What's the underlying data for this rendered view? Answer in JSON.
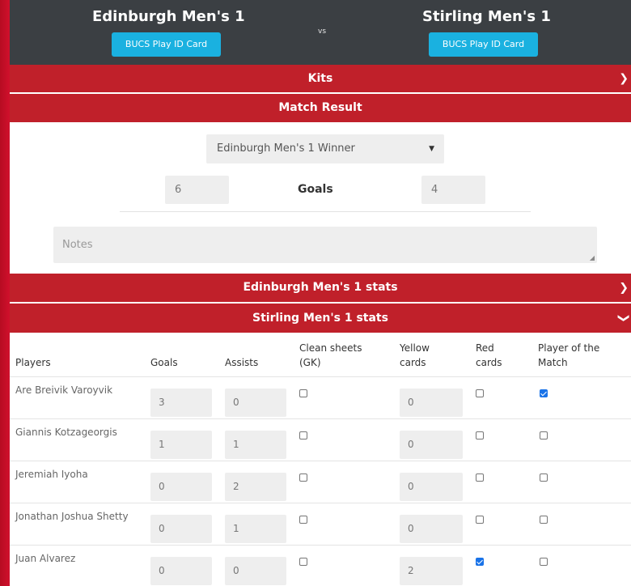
{
  "header": {
    "home_team": "Edinburgh Men's 1",
    "away_team": "Stirling Men's 1",
    "vs": "vs",
    "home_id_button": "BUCS Play ID Card",
    "away_id_button": "BUCS Play ID Card"
  },
  "sections": {
    "kits": "Kits",
    "match_result": "Match Result",
    "home_stats": "Edinburgh Men's 1 stats",
    "away_stats": "Stirling Men's 1 stats"
  },
  "result": {
    "winner_select": "Edinburgh Men's 1 Winner",
    "home_goals": "6",
    "goals_label": "Goals",
    "away_goals": "4",
    "notes_placeholder": "Notes"
  },
  "stats_table": {
    "headers": {
      "players": "Players",
      "goals": "Goals",
      "assists": "Assists",
      "clean_sheets": "Clean sheets (GK)",
      "yellow_cards": "Yellow cards",
      "red_cards": "Red cards",
      "potm": "Player of the Match"
    },
    "rows": [
      {
        "player": "Are Breivik Varoyvik",
        "goals": "3",
        "assists": "0",
        "clean_sheet": false,
        "yellow": "0",
        "red": false,
        "potm": true
      },
      {
        "player": "Giannis Kotzageorgis",
        "goals": "1",
        "assists": "1",
        "clean_sheet": false,
        "yellow": "0",
        "red": false,
        "potm": false
      },
      {
        "player": "Jeremiah Iyoha",
        "goals": "0",
        "assists": "2",
        "clean_sheet": false,
        "yellow": "0",
        "red": false,
        "potm": false
      },
      {
        "player": "Jonathan Joshua Shetty",
        "goals": "0",
        "assists": "1",
        "clean_sheet": false,
        "yellow": "0",
        "red": false,
        "potm": false
      },
      {
        "player": "Juan Alvarez",
        "goals": "0",
        "assists": "0",
        "clean_sheet": false,
        "yellow": "2",
        "red": true,
        "potm": false
      }
    ]
  },
  "colors": {
    "accent_red": "#c0202a",
    "header_dark": "#3b3f43",
    "button_blue": "#1ab1e0",
    "checkbox_blue": "#1a73e8"
  },
  "icons": {
    "expand": "chevron-right-icon",
    "collapse": "chevron-down-icon",
    "select_caret": "chevron-down-icon",
    "resize": "resize-grip-icon"
  }
}
